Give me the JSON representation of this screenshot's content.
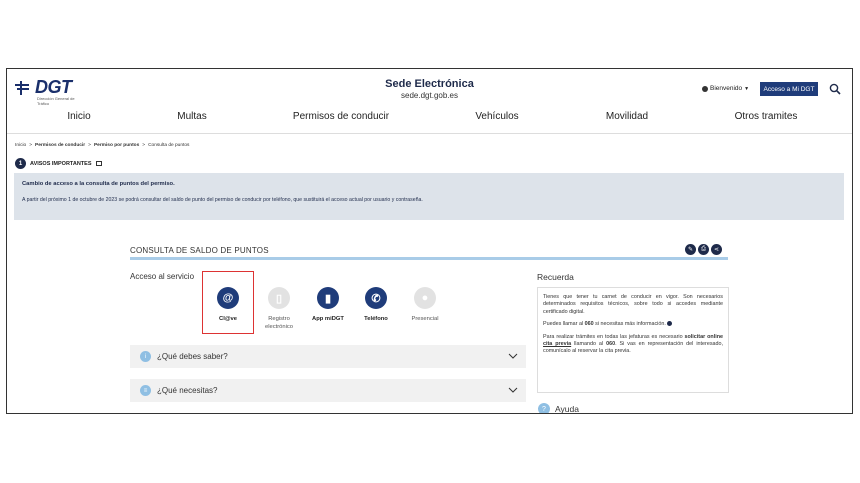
{
  "header": {
    "logo_text": "DGT",
    "logo_sub": "Dirección General de Tráfico",
    "title": "Sede Electrónica",
    "url": "sede.dgt.gob.es",
    "welcome": "Bienvenido",
    "mi_dgt_button": "Acceso a Mi DGT"
  },
  "nav": {
    "items": [
      "Inicio",
      "Multas",
      "Permisos de conducir",
      "Vehículos",
      "Movilidad",
      "Otros tramites"
    ]
  },
  "breadcrumb": {
    "items": [
      "Inicio",
      "Permisos de conducir",
      "Permiso por puntos",
      "Consulta de puntos"
    ],
    "separator": ">"
  },
  "avisos": {
    "count": "1",
    "label": "AVISOS IMPORTANTES"
  },
  "notice": {
    "title": "Cambio de acceso a la consulta de puntos del permiso.",
    "body": "A partir del próximo 1 de octubre de 2023 se podrá consultar del saldo de punto del permiso de conducir por teléfono, que sustituirá el acceso actual por usuario y contraseña."
  },
  "section": {
    "title": "CONSULTA DE SALDO DE PUNTOS",
    "acceso_label": "Acceso al servicio"
  },
  "services": [
    {
      "label": "Cl@ve",
      "icon": "clave-icon",
      "active": true
    },
    {
      "label": "Registro electrónico",
      "icon": "document-icon",
      "active": false
    },
    {
      "label": "App miDGT",
      "icon": "phone-app-icon",
      "active": true
    },
    {
      "label": "Teléfono",
      "icon": "telephone-icon",
      "active": true
    },
    {
      "label": "Presencial",
      "icon": "people-icon",
      "active": false
    }
  ],
  "accordions": [
    {
      "label": "¿Qué debes saber?"
    },
    {
      "label": "¿Qué necesitas?"
    }
  ],
  "recuerda": {
    "title": "Recuerda",
    "p1": "Tienes que tener tu carnet de conducir en vigor. Son necesarios determinados requisitos técnicos, sobre todo si accedes mediante certificado digital.",
    "p2_pre": "Puedes llamar al ",
    "p2_bold": "060",
    "p2_post": " si necesitas más información.",
    "p3_pre": "Para realizar trámites en todas las jefaturas es necesario ",
    "p3_bold1": "solicitar online",
    "p3_link": "cita previa",
    "p3_mid": " llamando al ",
    "p3_bold2": "060",
    "p3_post": ". Si vas en representación del interesado, comunícalo al reservar la cita previa."
  },
  "ayuda": {
    "label": "Ayuda"
  },
  "colors": {
    "primary": "#1f3c7a",
    "notice_bg": "#dde3ea",
    "section_bar": "#a9cce8",
    "highlight": "#dd3333"
  }
}
